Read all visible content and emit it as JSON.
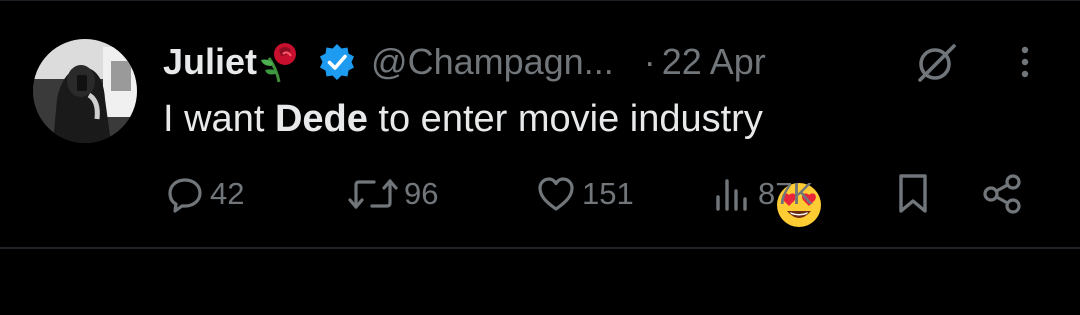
{
  "tweet": {
    "author_name": "Juliet",
    "handle": "@Champagn...",
    "separator": "·",
    "date": "22 Apr",
    "text_before": "I want ",
    "text_bold": "Dede",
    "text_after": " to enter movie industry"
  },
  "actions": {
    "replies": "42",
    "reposts": "96",
    "likes": "151",
    "views": "87K"
  },
  "colors": {
    "background": "#000000",
    "primary_text": "#e7e9ea",
    "secondary_text": "#71767b",
    "verified_badge": "#1d9bf0"
  },
  "icons": [
    "avatar",
    "rose-emoji-icon",
    "verified-badge-icon",
    "grok-icon",
    "more-options-icon",
    "heart-eyes-emoji-icon",
    "reply-icon",
    "repost-icon",
    "like-icon",
    "views-icon",
    "bookmark-icon",
    "share-icon"
  ]
}
